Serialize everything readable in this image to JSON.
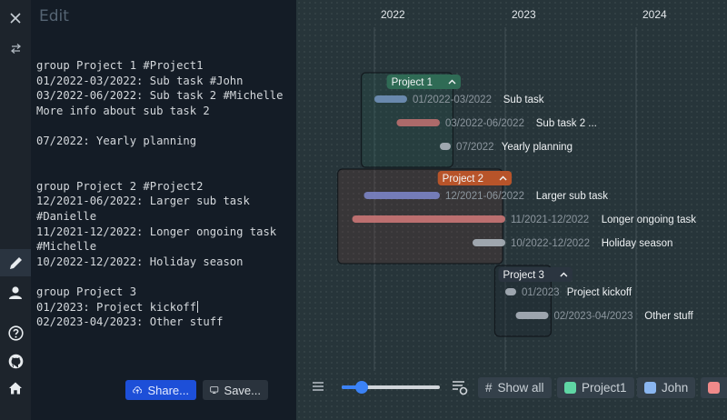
{
  "rail": {
    "icons": [
      "close-icon",
      "swap-icon",
      "edit-icon",
      "user-icon",
      "help-icon",
      "github-icon",
      "home-icon"
    ]
  },
  "editor": {
    "title": "Edit",
    "lines": [
      "group Project 1 #Project1",
      "01/2022-03/2022: Sub task #John",
      "03/2022-06/2022: Sub task 2 #Michelle",
      "More info about sub task 2",
      "",
      "07/2022: Yearly planning",
      "",
      "",
      "group Project 2 #Project2",
      "12/2021-06/2022: Larger sub task",
      "#Danielle",
      "11/2021-12/2022: Longer ongoing task",
      "#Michelle",
      "10/2022-12/2022: Holiday season",
      "",
      "group Project 3",
      "01/2023: Project kickoff",
      "02/2023-04/2023: Other stuff"
    ],
    "share_label": "Share...",
    "save_label": "Save..."
  },
  "timeline": {
    "years": [
      "2022",
      "2023",
      "2024"
    ],
    "groups": [
      {
        "name": "Project 1",
        "color": "#2f6b55",
        "start": 2021.9,
        "end": 2022.6,
        "events": [
          {
            "range": "01/2022-03/2022",
            "title": "Sub task",
            "start": 2022.0,
            "end": 2022.25,
            "color": "#6f8fb6"
          },
          {
            "range": "03/2022-06/2022",
            "title": "Sub task 2 ...",
            "start": 2022.17,
            "end": 2022.5,
            "color": "#b76e6e"
          },
          {
            "range": "07/2022",
            "title": "Yearly planning",
            "start": 2022.5,
            "end": 2022.58,
            "color": "#a8b0b8"
          }
        ]
      },
      {
        "name": "Project 2",
        "color": "#b8542a",
        "start": 2021.72,
        "end": 2022.98,
        "events": [
          {
            "range": "12/2021-06/2022",
            "title": "Larger sub task",
            "start": 2021.92,
            "end": 2022.5,
            "color": "#7a82c2"
          },
          {
            "range": "11/2021-12/2022",
            "title": "Longer ongoing task",
            "start": 2021.83,
            "end": 2023.0,
            "color": "#c87474"
          },
          {
            "range": "10/2022-12/2022",
            "title": "Holiday season",
            "start": 2022.75,
            "end": 2023.0,
            "color": "#a8b0b8"
          }
        ]
      },
      {
        "name": "Project 3",
        "color": "#2b3540",
        "start": 2022.92,
        "end": 2023.35,
        "events": [
          {
            "range": "01/2023",
            "title": "Project kickoff",
            "start": 2023.0,
            "end": 2023.08,
            "color": "#a8b0b8"
          },
          {
            "range": "02/2023-04/2023",
            "title": "Other stuff",
            "start": 2023.08,
            "end": 2023.33,
            "color": "#a8b0b8"
          }
        ]
      }
    ]
  },
  "toolbar": {
    "zoom_fraction": 0.2,
    "show_all_label": "Show all",
    "tags": [
      {
        "label": "Project1",
        "color": "#5fd6a4"
      },
      {
        "label": "John",
        "color": "#8ab6f0"
      },
      {
        "label": "",
        "color": "#f08a8a"
      }
    ]
  }
}
